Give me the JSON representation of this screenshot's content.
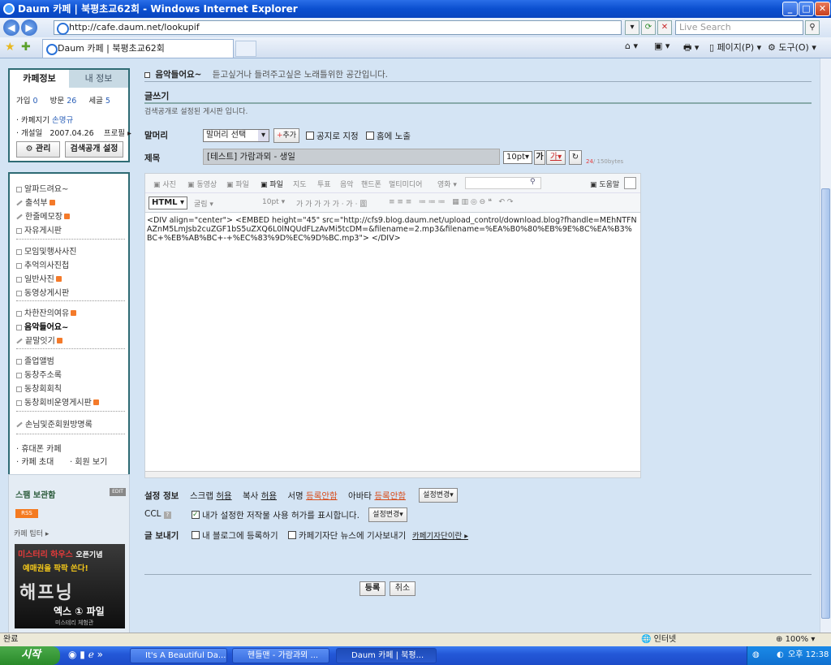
{
  "window": {
    "title": "Daum 카페 | 북평초교62회 - Windows Internet Explorer"
  },
  "browser": {
    "address": "http://cafe.daum.net/lookupif",
    "search_placeholder": "Live Search",
    "tab_label": "Daum 카페 | 북평초교62회",
    "page_menu": "페이지(P)",
    "tools_menu": "도구(O)"
  },
  "sidebar": {
    "tab_info": "카페정보",
    "tab_my": "내 정보",
    "join_label": "가입",
    "join_count": "0",
    "visit_label": "방문",
    "visit_count": "26",
    "post_label": "세글",
    "post_count": "5",
    "owner_label": "· 카페지기",
    "owner_name": "손명규",
    "opened_label": "· 개설일",
    "opened_date": "2007.04.26",
    "profile_link": "프로필 ▸",
    "manage_button": "⚙ 관리",
    "search_setting_button": "검색공개 설정",
    "menu_group1": [
      "알파드려요~",
      "출석부",
      "한줄메모장",
      "자유게시판"
    ],
    "menu_group2": [
      "모임및행사사진",
      "추억의사진첩",
      "일반사진",
      "동영상게시판"
    ],
    "menu_group3": [
      "차한잔의여유",
      "음악들어요~",
      "끝말잇기"
    ],
    "menu_group4": [
      "졸업앨범",
      "동창주소록",
      "동창회회칙",
      "동창회비운영게시판"
    ],
    "menu_group5": [
      "손님및준회원방명록"
    ],
    "mobile_cafe": "· 휴대폰 카페",
    "invite_cafe": "· 카페 초대",
    "member_view": "· 회원 보기",
    "spam_title": "스팸 보관함",
    "edit_badge": "EDIT",
    "rss_badge": "RSS",
    "cafe_tip": "카페 팁터 ▸",
    "banner_line1": "미스터리 하우스",
    "banner_line1b": "오픈기념",
    "banner_line2": "예매권을 팍팍 쏜다!",
    "banner_title": "해프닝",
    "banner_sub": "엑스 ① 파일",
    "banner_sub2": "미스테리 체험관"
  },
  "board": {
    "name": "음악들어요~",
    "desc": "듣고싶거나 들려주고싶은 노래틀위한 공간입니다."
  },
  "compose": {
    "heading": "글쓰기",
    "note": "검색공개로 설정된 게시판 입니다.",
    "prefix_label": "말머리",
    "prefix_select": "말머리 선택",
    "add_button": "추가",
    "notice_label": "공지로 지정",
    "home_label": "홈에 노출",
    "title_label": "제목",
    "title_value": "[테스트] 가람과뫼 - 생일",
    "font_size": "10pt",
    "font_bold": "가",
    "font_color": "가",
    "byte_count": "24",
    "byte_max": "/ 150bytes",
    "toolbar1": [
      "사진",
      "동영상",
      "파일",
      "파일",
      "지도",
      "투표",
      "음악",
      "핸드폰",
      "멀티미디어"
    ],
    "movie_select": "영화",
    "help": "도움말",
    "mode_select": "HTML",
    "font_select": "굴림",
    "size_select": "10pt",
    "source_html": "<DIV align=\"center\"> <EMBED height=\"45\" src=\"http://cfs9.blog.daum.net/upload_control/download.blog?fhandle=MEhNTFNAZnM5LmJsb2cuZGF1bS5uZXQ6L0lNQUdFLzAvMi5tcDM=&filename=2.mp3&filename=%EA%B0%80%EB%9E%8C%EA%B3%BC+%EB%AB%BC+-+%EC%83%9D%EC%9D%BC.mp3\"> </DIV>"
  },
  "settings": {
    "label": "설정 정보",
    "scrap": "스크랩",
    "scrap_val": "허용",
    "copy": "복사",
    "copy_val": "허용",
    "sign": "서명",
    "sign_val": "등록안함",
    "avatar": "아바타",
    "avatar_val": "등록안함",
    "change_button": "설정변경",
    "ccl_label": "CCL",
    "ccl_text": "내가 설정한 저작물 사용 허가를 표시합니다.",
    "send_label": "글 보내기",
    "blog_label": "내 블로그에 등록하기",
    "news_label": "카페기자단 뉴스에 기사보내기",
    "news_link": "카페기자단이란 ▸",
    "submit": "등록",
    "cancel": "취소"
  },
  "status": {
    "left": "완료",
    "zone": "인터넷",
    "zoom": "100%"
  },
  "taskbar": {
    "start": "시작",
    "tasks": [
      "It's A Beautiful Da...",
      "헨들맨 - 가람과뫼 ...",
      "Daum 카페 | 북평..."
    ],
    "clock": "오후 12:38"
  }
}
